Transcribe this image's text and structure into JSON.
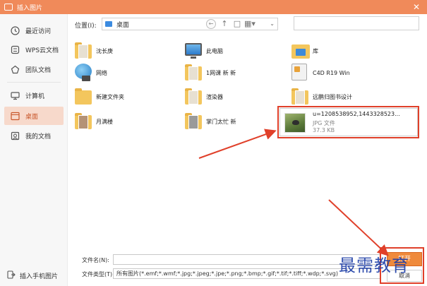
{
  "window": {
    "title": "插入图片",
    "close_label": "✕"
  },
  "sidebar": {
    "items": [
      {
        "label": "最近访问"
      },
      {
        "label": "WPS云文档"
      },
      {
        "label": "团队文档"
      },
      {
        "label": "计算机"
      },
      {
        "label": "桌面",
        "active": true
      },
      {
        "label": "我的文档"
      }
    ],
    "bottom_label": "插入手机图片"
  },
  "toolbar": {
    "location_label": "位置(I):",
    "location_value": "桌面",
    "search_placeholder": ""
  },
  "files": [
    {
      "name": "沈长庚",
      "icon": "user-folder-icon"
    },
    {
      "name": "此电脑",
      "icon": "computer-icon"
    },
    {
      "name": "库",
      "icon": "library-icon"
    },
    {
      "name": "网络",
      "icon": "network-icon"
    },
    {
      "name": "1网课  新  新",
      "icon": "folder-icon"
    },
    {
      "name": "C4D R19 Win",
      "icon": "folder-icon"
    },
    {
      "name": "新建文件夹",
      "icon": "folder-icon"
    },
    {
      "name": "渲染器",
      "icon": "folder-icon"
    },
    {
      "name": "远鹏归图书设计",
      "icon": "folder-icon"
    },
    {
      "name": "月满楼",
      "icon": "folder-icon"
    },
    {
      "name": "掌门太忙  新",
      "icon": "folder-icon"
    }
  ],
  "selected_file": {
    "name": "u=1208538952,1443328523...",
    "type": "JPG 文件",
    "size": "37.3 KB"
  },
  "bottom": {
    "filename_label": "文件名(N):",
    "filename_value": "",
    "filetype_label": "文件类型(T):",
    "filetype_value": "所有图片(*.emf;*.wmf;*.jpg;*.jpeg;*.jpe;*.png;*.bmp;*.gif;*.tif;*.tiff;*.wdp;*.svg)",
    "open_label": "打开",
    "cancel_label": "取消"
  },
  "watermark": "最需教育",
  "colors": {
    "accent": "#f08a5a",
    "annotation": "#e0402a",
    "watermark": "#1f3fa8"
  }
}
